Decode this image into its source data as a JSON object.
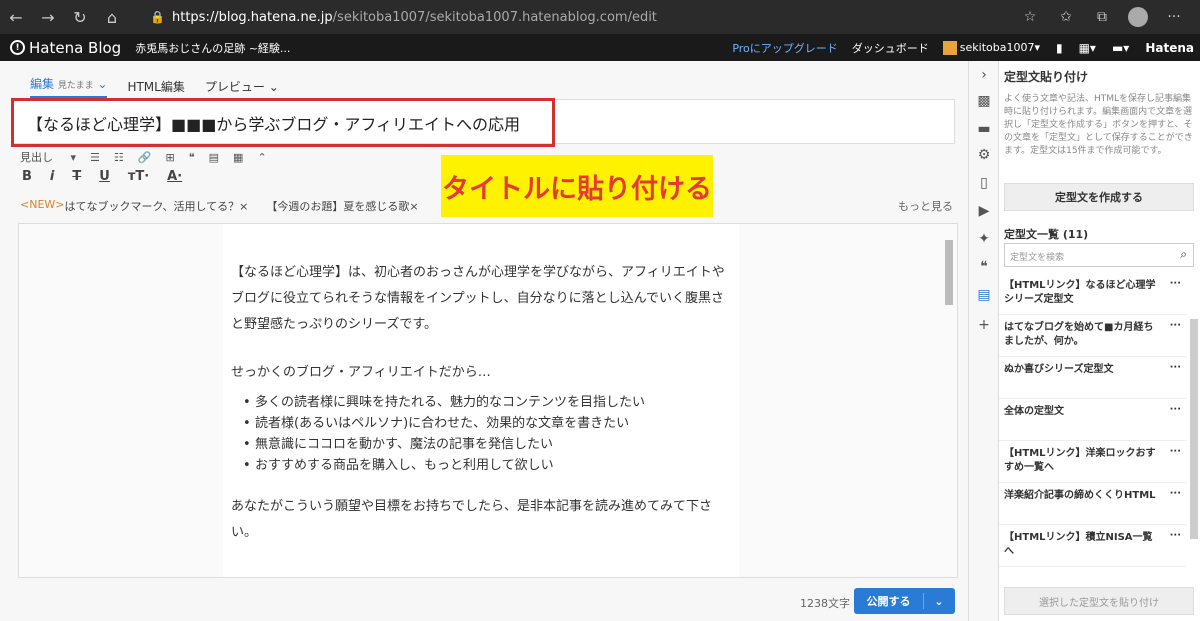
{
  "browser": {
    "url_host": "https://blog.hatena.ne.jp",
    "url_path": "/sekitoba1007/sekitoba1007.hatenablog.com/edit"
  },
  "header": {
    "logo": "Hatena Blog",
    "blog_name": "赤兎馬おじさんの足跡 ~経験...",
    "pro_upgrade": "Proにアップグレード",
    "dashboard": "ダッシュボード",
    "user": "sekitoba1007",
    "hatena": "Hatena"
  },
  "editor": {
    "tabs": [
      {
        "label": "編集",
        "sub": "見たまま"
      },
      {
        "label": "HTML編集"
      },
      {
        "label": "プレビュー"
      }
    ],
    "title_value": "【なるほど心理学】■■■から学ぶブログ・アフィリエイトへの応用",
    "toolbar_heading": "見出し",
    "annotation": "タイトルに貼り付ける",
    "news": {
      "new_tag": "<NEW>",
      "item1": "はてなブックマーク、活用してる？×",
      "item2": "【今週のお題】夏を感じる歌×",
      "more": "もっと見る"
    },
    "body": {
      "para1": "【なるほど心理学】は、初心者のおっさんが心理学を学びながら、アフィリエイトやブログに役立てられそうな情報をインプットし、自分なりに落とし込んでいく腹黒さと野望感たっぷりのシリーズです。",
      "para2": "せっかくのブログ・アフィリエイトだから…",
      "bullets": [
        "多くの読者様に興味を持たれる、魅力的なコンテンツを目指したい",
        "読者様(あるいはペルソナ)に合わせた、効果的な文章を書きたい",
        "無意識にココロを動かす、魔法の記事を発信したい",
        "おすすめする商品を購入し、もっと利用して欲しい"
      ],
      "para3": "あなたがこういう願望や目標をお持ちでしたら、是非本記事を読み進めてみて下さい。"
    },
    "char_count": "1238文字",
    "publish": "公開する"
  },
  "panel": {
    "title": "定型文貼り付け",
    "description": "よく使う文章や記法、HTMLを保存し記事編集時に貼り付けられます。編集画面内で文章を選択し「定型文を作成する」ボタンを押すと、その文章を「定型文」として保存することができます。定型文は15件まで作成可能です。",
    "create_button": "定型文を作成する",
    "list_title": "定型文一覧 (11)",
    "search_placeholder": "定型文を検索",
    "items": [
      "【HTMLリンク】なるほど心理学シリーズ定型文",
      "はてなブログを始めて■カ月経ちましたが、何か。",
      "ぬか喜びシリーズ定型文",
      "全体の定型文",
      "【HTMLリンク】洋楽ロックおすすめ一覧へ",
      "洋楽紹介記事の締めくくりHTML",
      "【HTMLリンク】積立NISA一覧へ"
    ],
    "paste_button": "選択した定型文を貼り付け"
  },
  "colors": {
    "accent": "#2a7bd5",
    "highlight": "#fff200",
    "annotation_text": "#e53935",
    "border_red": "#d32f2f"
  }
}
